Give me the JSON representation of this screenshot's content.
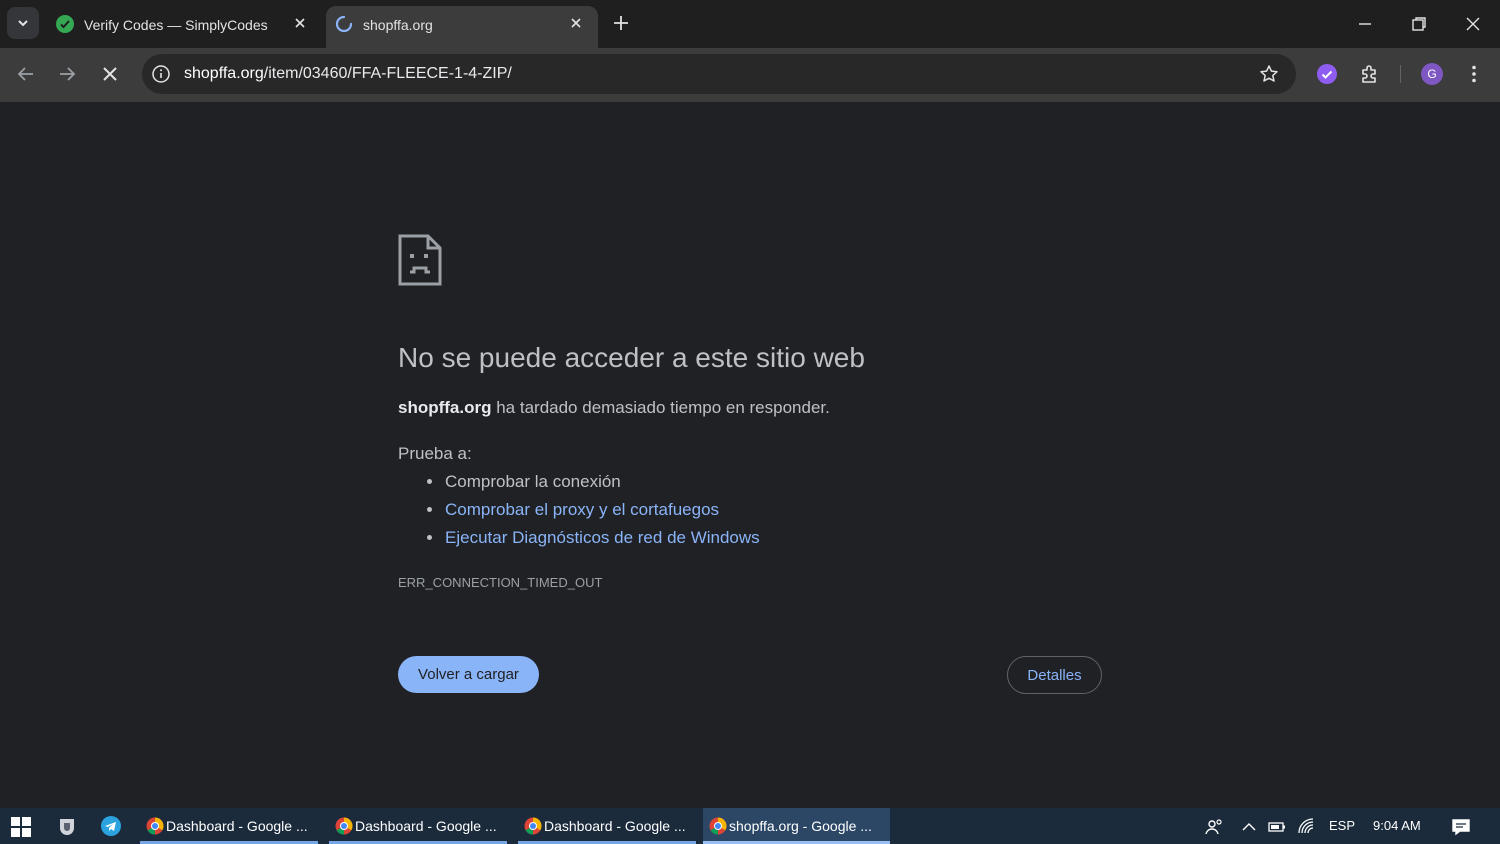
{
  "browser": {
    "tabs": [
      {
        "title": "Verify Codes — SimplyCodes",
        "active": false
      },
      {
        "title": "shopffa.org",
        "active": true
      }
    ],
    "url_domain": "shopffa.org",
    "url_path": "/item/03460/FFA-FLEECE-1-4-ZIP/",
    "profile_initial": "G"
  },
  "error_page": {
    "heading": "No se puede acceder a este sitio web",
    "lead_domain": "shopffa.org",
    "lead_text": " ha tardado demasiado tiempo en responder.",
    "try_label": "Prueba a:",
    "suggestions": [
      "Comprobar la conexión",
      "Comprobar el proxy y el cortafuegos",
      "Ejecutar Diagnósticos de red de Windows"
    ],
    "error_code": "ERR_CONNECTION_TIMED_OUT",
    "reload_label": "Volver a cargar",
    "details_label": "Detalles"
  },
  "taskbar": {
    "tasks": [
      "Dashboard - Google ...",
      "Dashboard - Google ...",
      "Dashboard - Google ...",
      "shopffa.org - Google ..."
    ],
    "language": "ESP",
    "time": "9:04 AM"
  },
  "colors": {
    "link": "#8ab4f8",
    "background": "#202124",
    "accent_green": "#34a853"
  }
}
